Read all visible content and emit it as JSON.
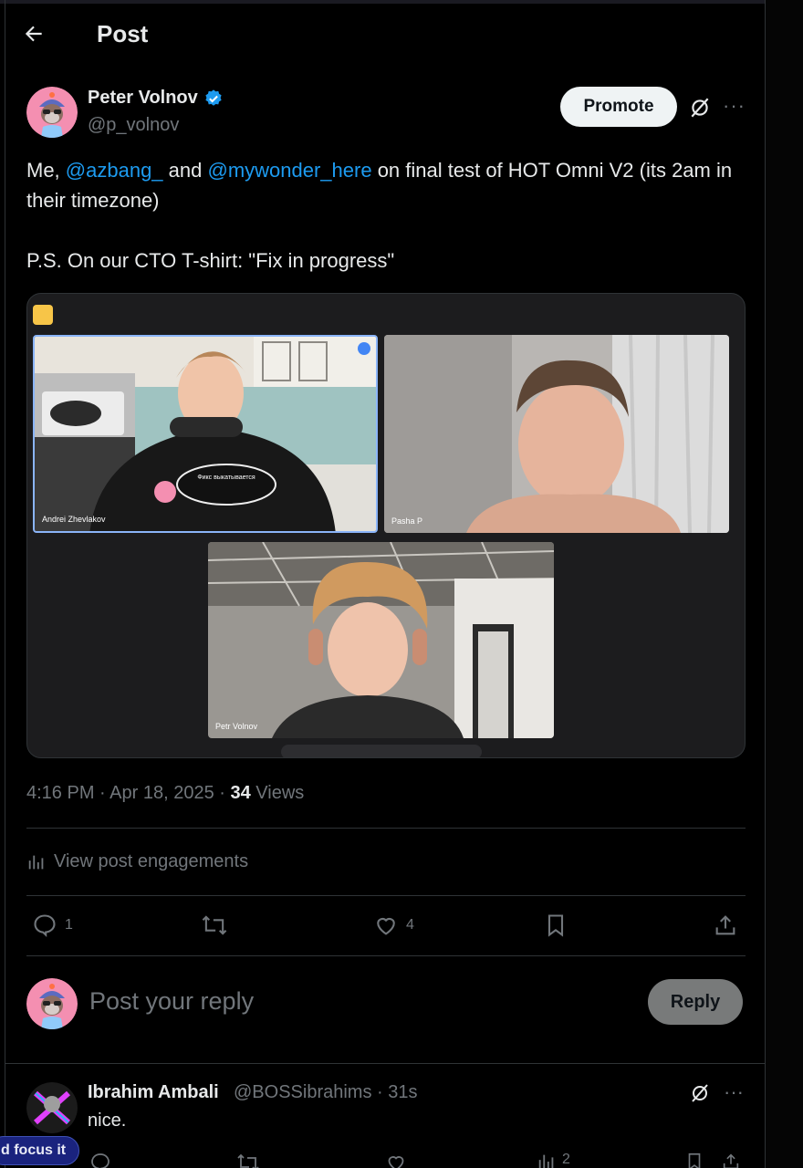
{
  "header": {
    "title": "Post"
  },
  "post": {
    "author_name": "Peter Volnov",
    "author_handle": "@p_volnov",
    "promote_label": "Promote",
    "text_line1_a": "Me, ",
    "mention1": "@azbang_",
    "text_line1_b": " and ",
    "mention2": "@mywonder_here",
    "text_line1_c": " on final test of HOT Omni V2 (its 2am in their timezone)",
    "text_line2": "P.S. On our CTO  T-shirt: \"Fix in progress\"",
    "media": {
      "tile1_label": "Andrei Zhevlakov",
      "tile2_label": "Pasha P",
      "tile3_label": "Petr Volnov",
      "shirt_text": "Фикс выкатывается"
    },
    "time": "4:16 PM",
    "date": "Apr 18, 2025",
    "views_count": "34",
    "views_label": "Views",
    "engagements_label": "View post engagements",
    "actions": {
      "replies": "1",
      "likes": "4"
    }
  },
  "reply_box": {
    "placeholder": "Post your reply",
    "button_label": "Reply"
  },
  "comment": {
    "name": "Ibrahim Ambali",
    "handle": "@BOSSibrahims · 31s",
    "text": "nice.",
    "views": "2"
  },
  "toast": {
    "text": "d focus it"
  },
  "colors": {
    "accent": "#1d9bf0",
    "muted": "#71767b",
    "text": "#e7e9ea",
    "background": "#000000"
  }
}
